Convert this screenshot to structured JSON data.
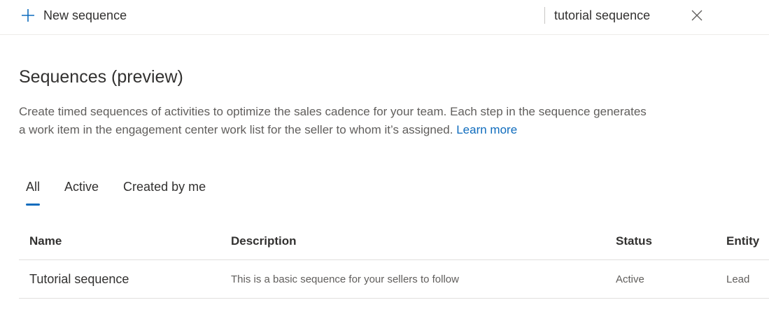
{
  "toolbar": {
    "new_sequence_label": "New sequence",
    "new_sequence_icon": "plus-icon",
    "search_value": "tutorial sequence",
    "clear_icon": "close-icon",
    "accent": "#0f6cbd"
  },
  "page": {
    "title": "Sequences (preview)",
    "description": "Create timed sequences of activities to optimize the sales cadence for your team. Each step in the sequence generates a work item in the engagement center work list for the seller to whom it’s assigned.",
    "learn_more": "Learn more"
  },
  "tabs": [
    {
      "label": "All",
      "active": true
    },
    {
      "label": "Active",
      "active": false
    },
    {
      "label": "Created by me",
      "active": false
    }
  ],
  "table": {
    "columns": [
      "Name",
      "Description",
      "Status",
      "Entity"
    ],
    "rows": [
      {
        "name": "Tutorial sequence",
        "description": "This is a basic sequence for your sellers to follow",
        "status": "Active",
        "entity": "Lead"
      }
    ]
  }
}
